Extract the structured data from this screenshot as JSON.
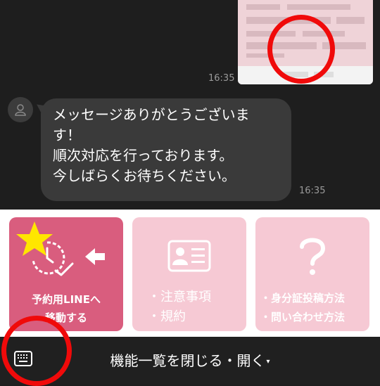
{
  "chat": {
    "sent_image_time": "16:35",
    "message": {
      "lines": [
        "メッセージありがとうございま",
        "す！",
        "順次対応を行っております。",
        "今しばらくお待ちください。"
      ],
      "time": "16:35"
    }
  },
  "menu": {
    "tiles": [
      {
        "lines": [
          "予約用LINEへ",
          "移動する"
        ],
        "icon": "clock-check-arrow-icon",
        "badge": "star-icon"
      },
      {
        "lines": [
          "・注意事項",
          "・規約"
        ],
        "icon": "id-card-icon"
      },
      {
        "lines": [
          "・身分証投稿方法",
          "・問い合わせ方法"
        ],
        "icon": "question-mark-icon"
      }
    ]
  },
  "bottom_bar": {
    "title": "機能一覧を閉じる・開く",
    "caret": "▾",
    "keyboard_icon": "keyboard-icon"
  },
  "colors": {
    "chat_bg": "#1e1e1e",
    "bubble_bg": "#3a3a3a",
    "tile_primary": "#d95d7e",
    "tile_secondary": "#f6c9d4",
    "annotation_red": "#f00a0a",
    "star": "#ffe600"
  }
}
